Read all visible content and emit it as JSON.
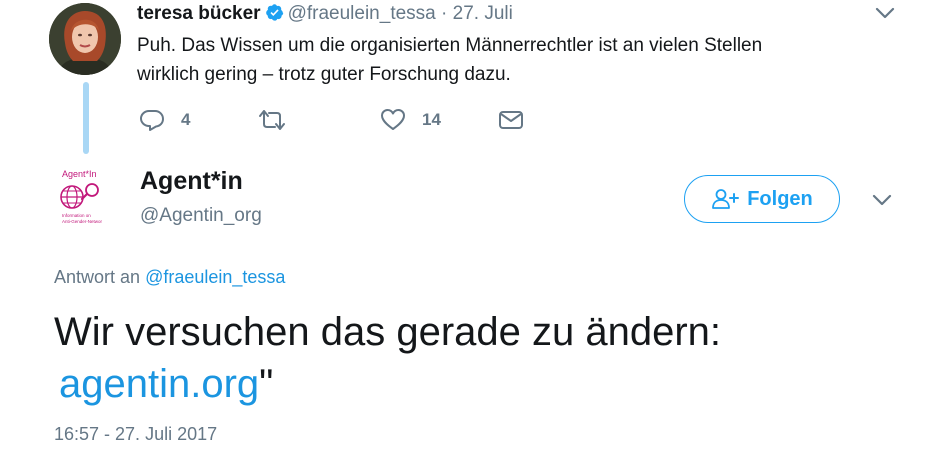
{
  "parent_tweet": {
    "name": "teresa bücker",
    "handle": "@fraeulein_tessa",
    "separator": "·",
    "date": "27. Juli",
    "text_line1": "Puh. Das Wissen um die organisierten Männerrechtler ist an vielen Stellen",
    "text_line2": "wirklich gering – trotz guter Forschung dazu.",
    "reply_count": "4",
    "like_count": "14",
    "icons": [
      "verified-badge-icon",
      "chevron-down-icon",
      "reply-icon",
      "retweet-icon",
      "heart-icon",
      "envelope-icon"
    ]
  },
  "reply_tweet": {
    "name": "Agent*in",
    "handle": "@Agentin_org",
    "follow_label": "Folgen",
    "reply_to_prefix": "Antwort an",
    "reply_to_handle": "@fraeulein_tessa",
    "text": "Wir versuchen das gerade zu ändern:",
    "link": "agentin.org",
    "text_suffix": "\"",
    "timestamp": "16:57 - 27. Juli 2017",
    "logo": {
      "title": "Agent*In",
      "subtitle_line1": "Information on",
      "subtitle_line2": "Anti-Gender-Networ"
    },
    "icons": [
      "follow-user-icon",
      "chevron-down-icon",
      "globe-icon",
      "magnifier-icon"
    ]
  },
  "colors": {
    "accent": "#1da1f2",
    "link": "#1b95e0",
    "secondary_text": "#657786",
    "thread_line": "#a9d7f5",
    "logo_pink": "#c2187b"
  }
}
